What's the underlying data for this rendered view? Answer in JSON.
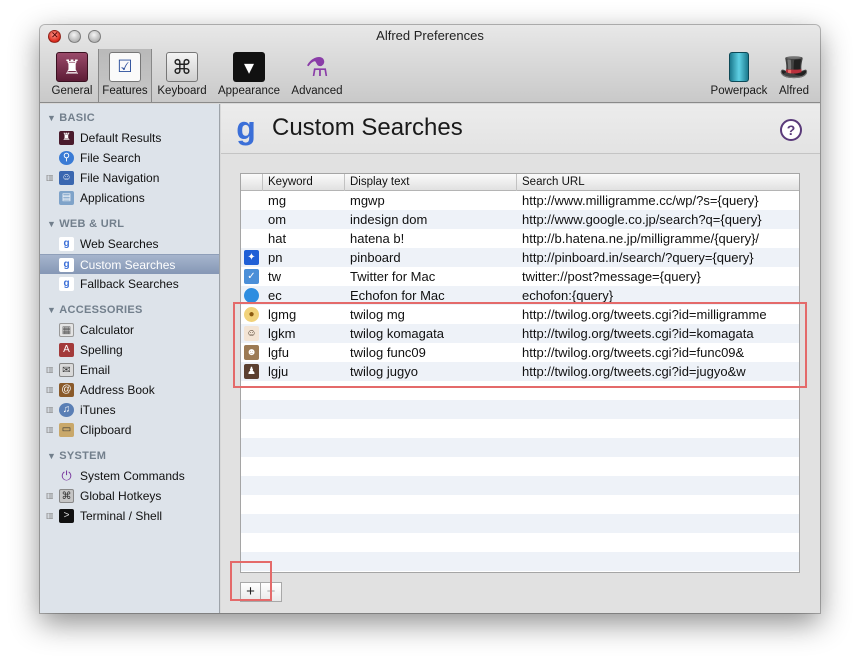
{
  "window": {
    "title": "Alfred Preferences"
  },
  "toolbar": {
    "items": [
      {
        "label": "General",
        "icon": "hat-icon"
      },
      {
        "label": "Features",
        "icon": "checklist-icon"
      },
      {
        "label": "Keyboard",
        "icon": "command-key-icon"
      },
      {
        "label": "Appearance",
        "icon": "tuxedo-icon"
      },
      {
        "label": "Advanced",
        "icon": "flask-icon"
      },
      {
        "label": "Powerpack",
        "icon": "battery-icon"
      },
      {
        "label": "Alfred",
        "icon": "alfred-hat-icon"
      }
    ]
  },
  "sidebar": {
    "sections": [
      {
        "title": "BASIC",
        "items": [
          {
            "label": "Default Results",
            "icon": "hat-icon"
          },
          {
            "label": "File Search",
            "icon": "magnifier-icon"
          },
          {
            "label": "File Navigation",
            "icon": "finder-icon"
          },
          {
            "label": "Applications",
            "icon": "folder-icon"
          }
        ]
      },
      {
        "title": "WEB & URL",
        "items": [
          {
            "label": "Web Searches",
            "icon": "google-icon"
          },
          {
            "label": "Custom Searches",
            "icon": "google-icon"
          },
          {
            "label": "Fallback Searches",
            "icon": "google-icon"
          }
        ]
      },
      {
        "title": "ACCESSORIES",
        "items": [
          {
            "label": "Calculator",
            "icon": "calculator-icon"
          },
          {
            "label": "Spelling",
            "icon": "dictionary-icon"
          },
          {
            "label": "Email",
            "icon": "mail-icon"
          },
          {
            "label": "Address Book",
            "icon": "address-book-icon"
          },
          {
            "label": "iTunes",
            "icon": "itunes-icon"
          },
          {
            "label": "Clipboard",
            "icon": "clipboard-icon"
          }
        ]
      },
      {
        "title": "SYSTEM",
        "items": [
          {
            "label": "System Commands",
            "icon": "power-icon"
          },
          {
            "label": "Global Hotkeys",
            "icon": "hotkey-icon"
          },
          {
            "label": "Terminal / Shell",
            "icon": "terminal-icon"
          }
        ]
      }
    ]
  },
  "main": {
    "title": "Custom Searches",
    "help": "?",
    "columns": [
      "Keyword",
      "Display text",
      "Search URL"
    ],
    "rows": [
      {
        "keyword": "mg",
        "display": "mgwp",
        "url": "http://www.milligramme.cc/wp/?s={query}",
        "icon": ""
      },
      {
        "keyword": "om",
        "display": "indesign dom",
        "url": "http://www.google.co.jp/search?q={query}",
        "icon": ""
      },
      {
        "keyword": "hat",
        "display": "hatena b!",
        "url": "http://b.hatena.ne.jp/milligramme/{query}/",
        "icon": ""
      },
      {
        "keyword": "pn",
        "display": "pinboard",
        "url": "http://pinboard.in/search/?query={query}",
        "icon": "pinboard-icon"
      },
      {
        "keyword": "tw",
        "display": "Twitter for Mac",
        "url": "twitter://post?message={query}",
        "icon": "twitter-bird-icon"
      },
      {
        "keyword": "ec",
        "display": "Echofon for Mac",
        "url": "echofon:{query}",
        "icon": "echofon-icon"
      },
      {
        "keyword": "lgmg",
        "display": "twilog mg",
        "url": "http://twilog.org/tweets.cgi?id=milligramme",
        "icon": "avatar-mg-icon"
      },
      {
        "keyword": "lgkm",
        "display": "twilog komagata",
        "url": "http://twilog.org/tweets.cgi?id=komagata",
        "icon": "avatar-km-icon"
      },
      {
        "keyword": "lgfu",
        "display": "twilog func09",
        "url": "http://twilog.org/tweets.cgi?id=func09&",
        "icon": "avatar-fu-icon"
      },
      {
        "keyword": "lgju",
        "display": "twilog jugyo",
        "url": "http://twilog.org/tweets.cgi?id=jugyo&w",
        "icon": "avatar-ju-icon"
      }
    ],
    "add_label": "+",
    "remove_label": "−"
  }
}
